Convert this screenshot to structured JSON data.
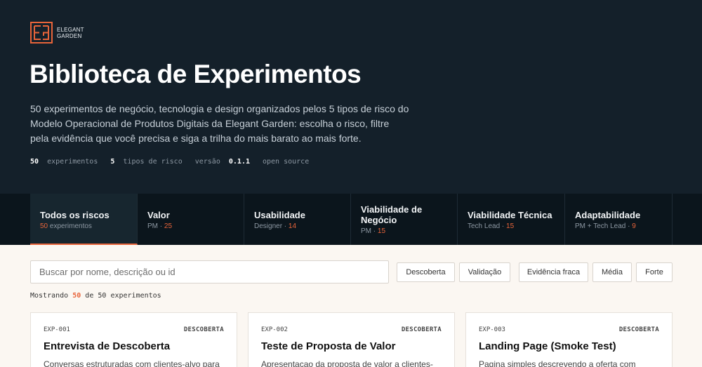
{
  "brand": {
    "line1": "ELEGANT",
    "line2": "GARDEN",
    "accent": "#e8643a"
  },
  "hero": {
    "title": "Biblioteca de Experimentos",
    "description": "50 experimentos de negócio, tecnologia e design organizados pelos 5 tipos de risco do Modelo Operacional de Produtos Digitais da Elegant Garden: escolha o risco, filtre pela evidência que você precisa e siga a trilha do mais barato ao mais forte.",
    "meta": {
      "count": "50",
      "count_label": "experimentos",
      "risks": "5",
      "risks_label": "tipos de risco",
      "version_label": "versão",
      "version": "0.1.1",
      "license": "open source"
    }
  },
  "tabs": [
    {
      "name": "Todos os riscos",
      "sub_prefix": "",
      "sub_num": "50",
      "sub_suffix": " experimentos"
    },
    {
      "name": "Valor",
      "sub_prefix": "PM · ",
      "sub_num": "25",
      "sub_suffix": ""
    },
    {
      "name": "Usabilidade",
      "sub_prefix": "Designer · ",
      "sub_num": "14",
      "sub_suffix": ""
    },
    {
      "name": "Viabilidade de Negócio",
      "sub_prefix": "PM · ",
      "sub_num": "15",
      "sub_suffix": ""
    },
    {
      "name": "Viabilidade Técnica",
      "sub_prefix": "Tech Lead · ",
      "sub_num": "15",
      "sub_suffix": ""
    },
    {
      "name": "Adaptabilidade",
      "sub_prefix": "PM + Tech Lead · ",
      "sub_num": "9",
      "sub_suffix": ""
    }
  ],
  "search": {
    "placeholder": "Buscar por nome, descrição ou id"
  },
  "filters": {
    "stage": [
      "Descoberta",
      "Validação"
    ],
    "evidence": [
      "Evidência fraca",
      "Média",
      "Forte"
    ]
  },
  "showing": {
    "prefix": "Mostrando",
    "count": "50",
    "middle": "de",
    "total": "50",
    "suffix": "experimentos"
  },
  "cards": [
    {
      "id": "EXP-001",
      "stage": "DESCOBERTA",
      "title": "Entrevista de Descoberta",
      "text": "Conversas estruturadas com clientes-alvo para"
    },
    {
      "id": "EXP-002",
      "stage": "DESCOBERTA",
      "title": "Teste de Proposta de Valor",
      "text": "Apresentacao da proposta de valor a clientes-"
    },
    {
      "id": "EXP-003",
      "stage": "DESCOBERTA",
      "title": "Landing Page (Smoke Test)",
      "text": "Pagina simples descrevendo a oferta com"
    }
  ]
}
